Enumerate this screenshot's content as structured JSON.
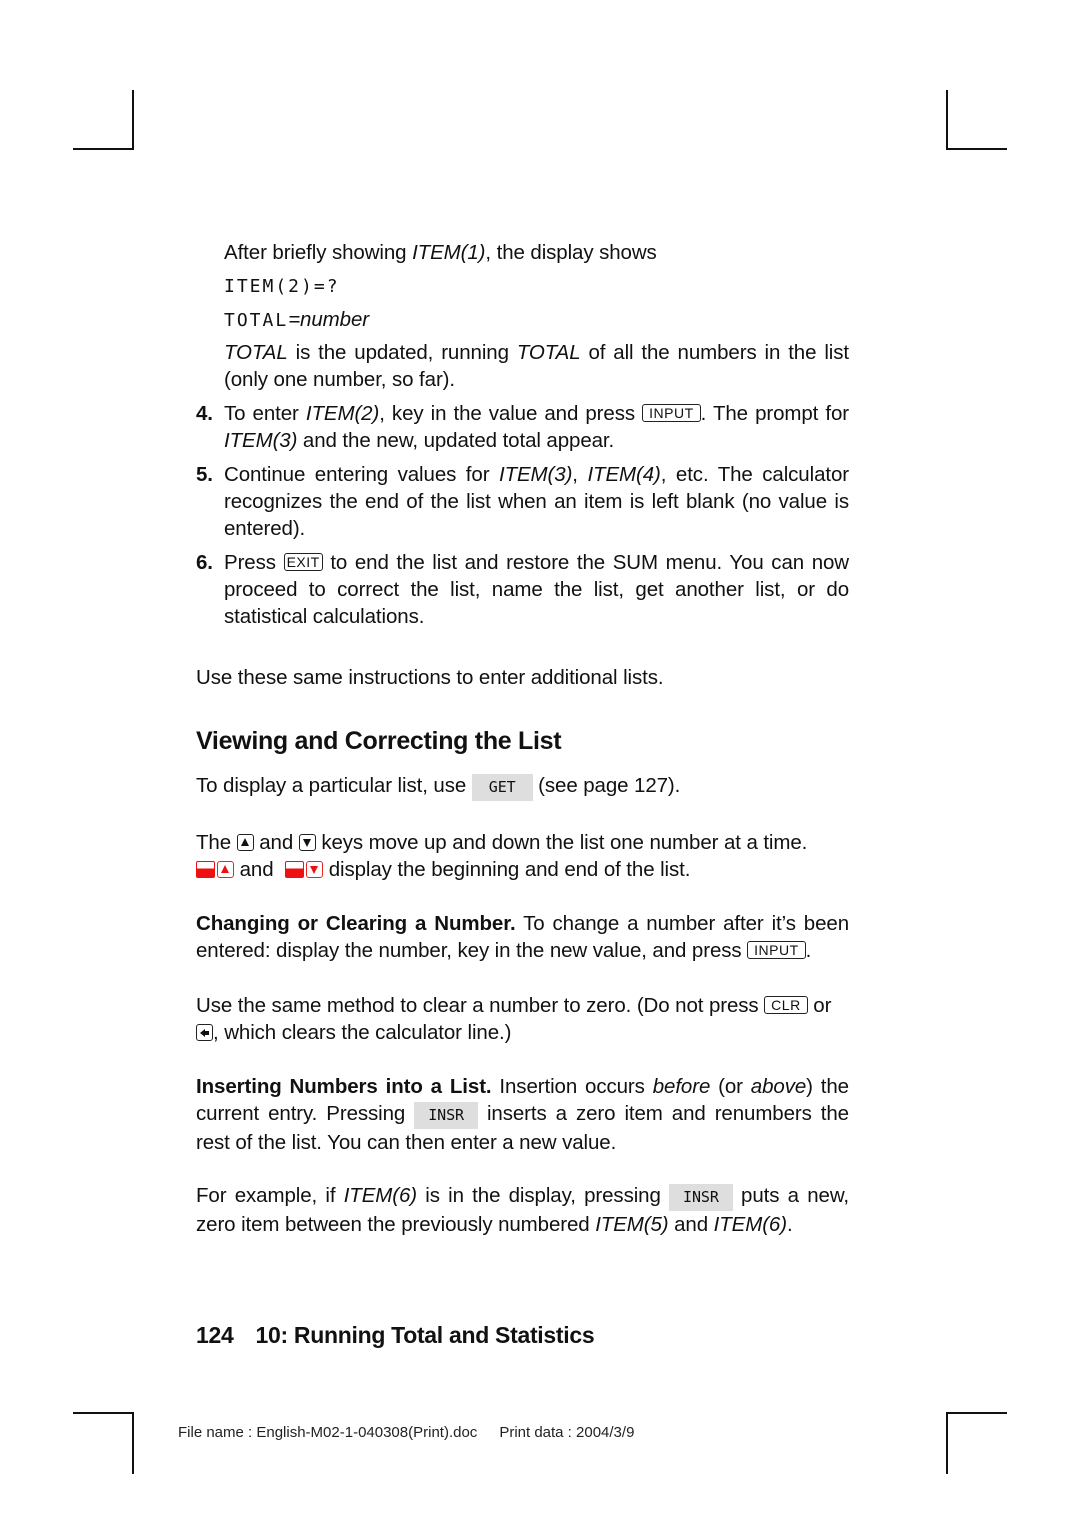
{
  "page": {
    "continuation": {
      "intro": [
        "After briefly showing ",
        "ITEM(1)",
        ", the display shows"
      ],
      "display_line1": "ITEM(2)=?",
      "display_line2_prefix": "TOTAL",
      "display_line2_suffix": "=number",
      "total_note": [
        "TOTAL",
        " is the updated, running ",
        "TOTAL",
        " of all the numbers in the list (only one number, so far)."
      ]
    },
    "steps": [
      {
        "number": "4.",
        "parts": [
          "To enter ",
          "ITEM(2)",
          ", key in the value and press ",
          ". The prompt for ",
          "ITEM(3)",
          " and the new, updated total appear."
        ],
        "key": "INPUT"
      },
      {
        "number": "5.",
        "parts": [
          "Continue entering values for ",
          "ITEM(3)",
          ", ",
          "ITEM(4)",
          ", etc. The calculator recognizes the end of the list when an item is left blank (no value is entered)."
        ]
      },
      {
        "number": "6.",
        "parts": [
          "Press ",
          " to end the list and restore the SUM menu. You can now proceed to correct the list, name the list, get another list, or do statistical calculations."
        ],
        "key": "EXIT"
      }
    ],
    "additional_lists": "Use these same instructions to enter additional lists.",
    "section": {
      "heading": "Viewing and Correcting the List",
      "get_para": [
        "To display a particular list, use ",
        " (see page 127)."
      ],
      "get_key": "GET",
      "arrows_para": {
        "p1": "The ",
        "p2": " and ",
        "p3": " keys move up and down the list one number at a time.",
        "p4": " and ",
        "p5": " display the beginning and end of the list."
      },
      "changing": {
        "runin": "Changing or Clearing a Number.",
        "text": " To change a number after it’s been entered: display the number, key in the new value, and press ",
        "key": "INPUT",
        "end": "."
      },
      "clearing": {
        "text1": "Use the same method to clear a number to zero. (Do not press ",
        "key": "CLR",
        "text2": " or ",
        "text3": ", which clears the calculator line.)"
      },
      "inserting": {
        "runin": "Inserting Numbers into a List.",
        "t1": " Insertion occurs ",
        "em1": "before",
        "t2": " (or ",
        "em2": "above",
        "t3": ") the current entry. Pressing ",
        "key": "INSR",
        "t4": " inserts a zero item and renumbers the rest of the list. You can then enter a new value."
      },
      "example": {
        "t1": "For example, if ",
        "em1": "ITEM(6)",
        "t2": " is in the display, pressing ",
        "key": "INSR",
        "t3": " puts a new, zero item between the previously numbered ",
        "em2": "ITEM(5)",
        "t4": " and ",
        "em3": "ITEM(6)",
        "t5": "."
      }
    },
    "footer": {
      "page_number": "124",
      "chapter": "10: Running Total and Statistics"
    },
    "print_info": {
      "file_name": "File name : English-M02-1-040308(Print).doc",
      "print_date": "Print data : 2004/3/9"
    },
    "colors": {
      "shift_key": "#ee1111",
      "menu_key_bg": "#dedede",
      "text": "#111111"
    }
  }
}
